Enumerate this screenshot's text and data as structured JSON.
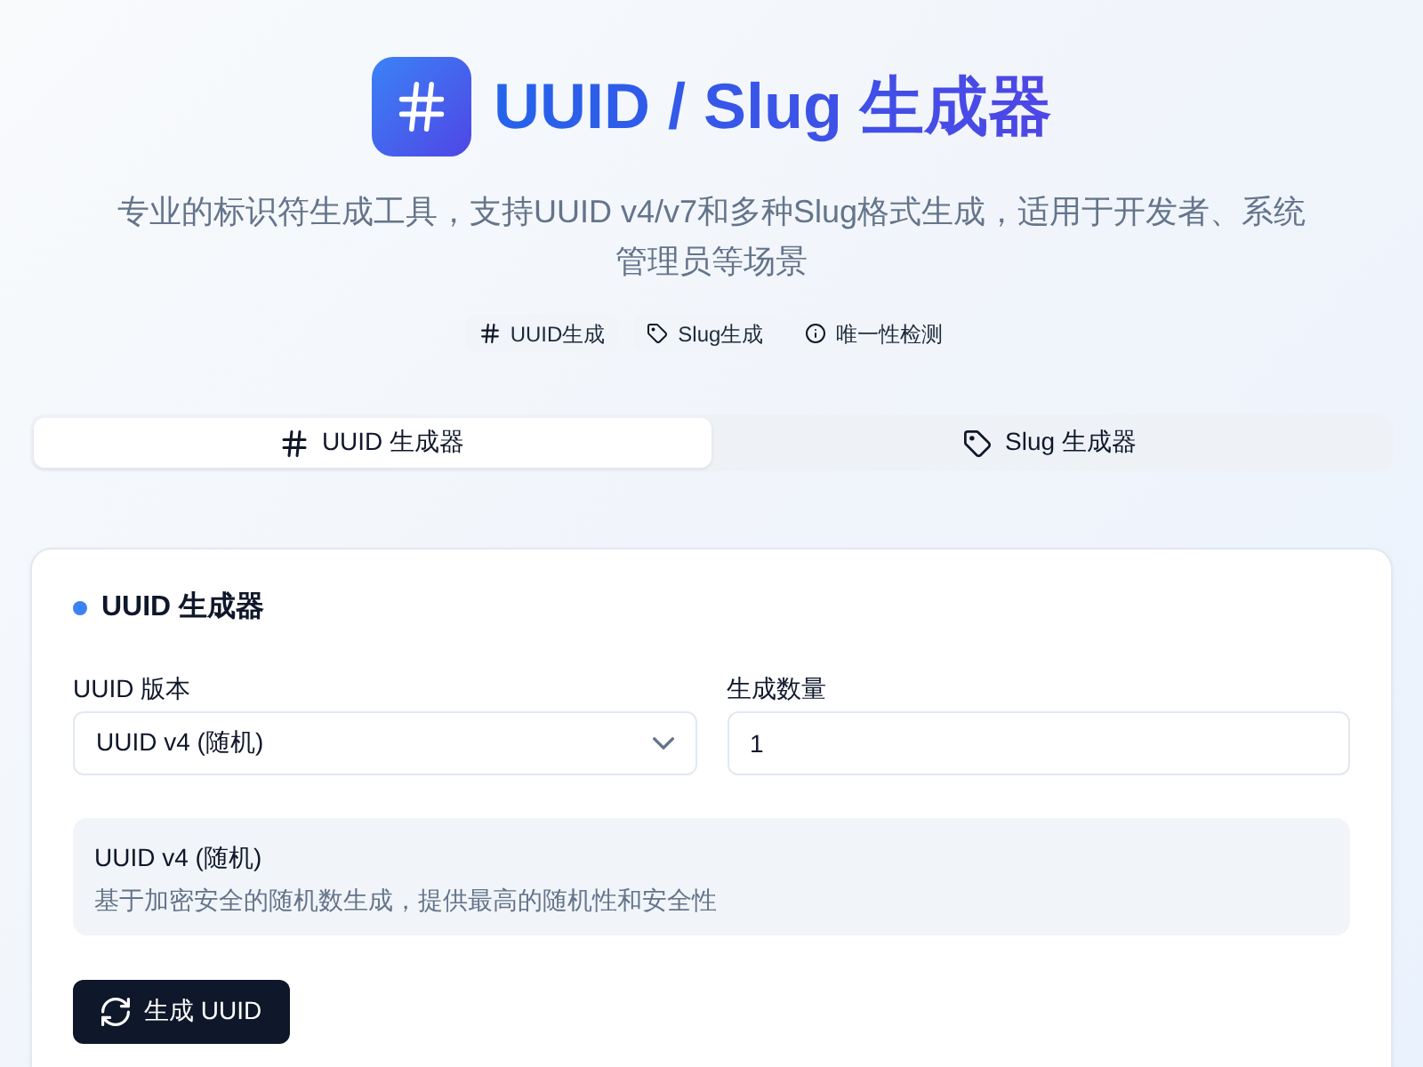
{
  "header": {
    "title": "UUID / Slug 生成器",
    "subtitle": "专业的标识符生成工具，支持UUID v4/v7和多种Slug格式生成，适用于开发者、系统管理员等场景",
    "badges": [
      {
        "kind": "hash",
        "label": "UUID生成"
      },
      {
        "kind": "tag",
        "label": "Slug生成"
      },
      {
        "kind": "info",
        "label": "唯一性检测"
      }
    ]
  },
  "tabs": [
    {
      "kind": "hash",
      "label": "UUID 生成器",
      "selected": true
    },
    {
      "kind": "tag",
      "label": "Slug 生成器",
      "selected": false
    }
  ],
  "panel": {
    "title": "UUID 生成器",
    "fields": [
      {
        "kind": "select",
        "label": "UUID 版本",
        "value": "UUID v4 (随机)"
      },
      {
        "kind": "input",
        "label": "生成数量",
        "value": "1"
      }
    ],
    "info": {
      "title": "UUID v4 (随机)",
      "description": "基于加密安全的随机数生成，提供最高的随机性和安全性"
    },
    "button": {
      "label": "生成 UUID"
    }
  }
}
